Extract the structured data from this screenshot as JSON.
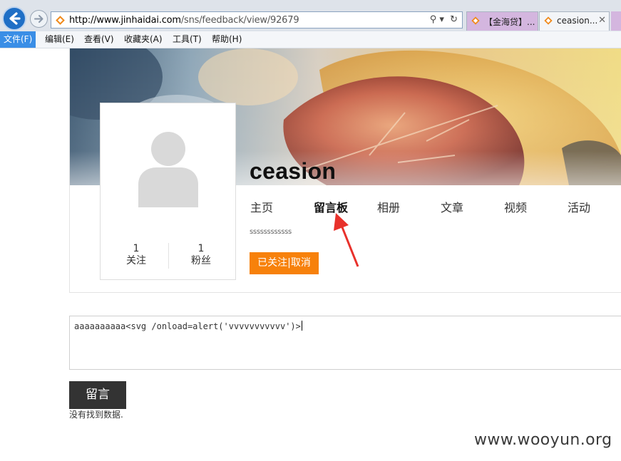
{
  "browser": {
    "url_domain": "http://www.jinhaidai.com",
    "url_path": "/sns/feedback/view/92679",
    "tabs": [
      {
        "label": "【金海贷】..."
      },
      {
        "label": "ceasion..."
      }
    ],
    "tab_close": "✕",
    "address_tools": {
      "search": "⚲ ▾",
      "refresh": "↻"
    }
  },
  "menubar": {
    "items": [
      {
        "label": "文件(F)"
      },
      {
        "label": "编辑(E)"
      },
      {
        "label": "查看(V)"
      },
      {
        "label": "收藏夹(A)"
      },
      {
        "label": "工具(T)"
      },
      {
        "label": "帮助(H)"
      }
    ]
  },
  "profile": {
    "username": "ceasion",
    "signature": "ssssssssssss",
    "stats": [
      {
        "count": "1",
        "label": "关注"
      },
      {
        "count": "1",
        "label": "粉丝"
      }
    ],
    "follow": {
      "status": "已关注",
      "cancel": "取消"
    }
  },
  "nav": {
    "items": [
      {
        "label": "主页"
      },
      {
        "label": "留言板"
      },
      {
        "label": "相册"
      },
      {
        "label": "文章"
      },
      {
        "label": "视频"
      },
      {
        "label": "活动"
      }
    ],
    "current_index": 1
  },
  "message": {
    "input_value": "aaaaaaaaaa<svg /onload=alert('vvvvvvvvvvv')>",
    "post_label": "留言",
    "empty_text": "没有找到数据."
  },
  "watermark": "www.wooyun.org",
  "colors": {
    "accent_orange": "#f7810b",
    "post_button": "#333333",
    "annotation_red": "#e8312b",
    "menu_active": "#3a8ee6"
  }
}
